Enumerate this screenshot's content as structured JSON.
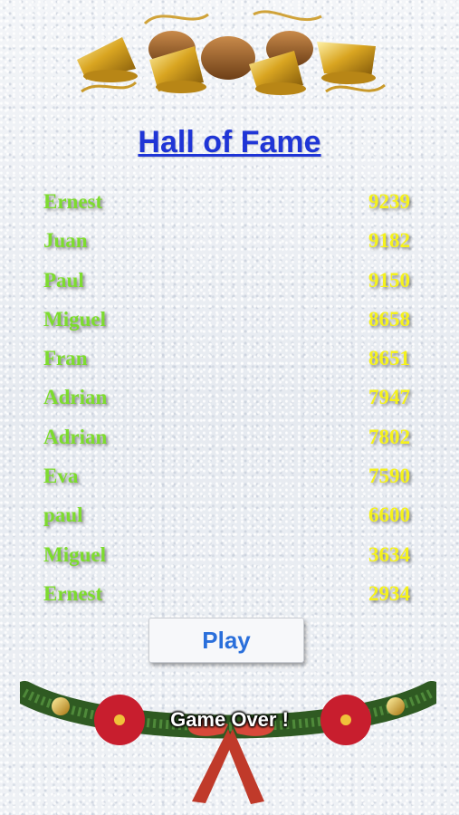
{
  "title": "Hall of Fame",
  "scores": [
    {
      "name": "Ernest",
      "score": "9239"
    },
    {
      "name": "Juan",
      "score": "9182"
    },
    {
      "name": "Paul",
      "score": "9150"
    },
    {
      "name": "Miguel",
      "score": "8658"
    },
    {
      "name": "Fran",
      "score": "8651"
    },
    {
      "name": "Adrian",
      "score": "7947"
    },
    {
      "name": "Adrian",
      "score": "7802"
    },
    {
      "name": "Eva",
      "score": "7590"
    },
    {
      "name": "paul",
      "score": "6600"
    },
    {
      "name": "Miguel",
      "score": "3634"
    },
    {
      "name": "Ernest",
      "score": "2934"
    }
  ],
  "play_label": "Play",
  "game_over": "Game Over !",
  "colors": {
    "title": "#1f35d6",
    "name": "#7ddc2e",
    "score": "#f5f21c",
    "play_text": "#2a6fdb"
  },
  "decor": {
    "top": "golden-bells-pinecones-icon",
    "bottom": "christmas-garland-poinsettia-icon"
  }
}
